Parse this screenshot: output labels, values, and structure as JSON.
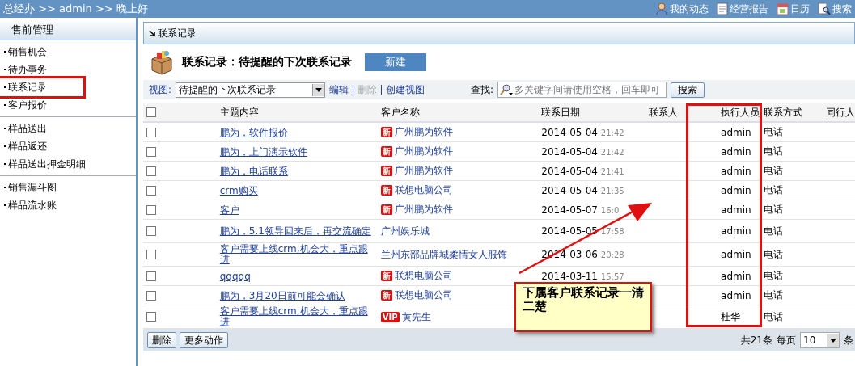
{
  "top_bar": {
    "breadcrumb": "总经办 >> admin >> 晚上好",
    "links": [
      {
        "label": "我的动态"
      },
      {
        "label": "经营报告"
      },
      {
        "label": "日历"
      },
      {
        "label": "搜索"
      }
    ]
  },
  "sidebar": {
    "title": "售前管理",
    "groups": [
      {
        "items": [
          {
            "label": "销售机会",
            "highlighted": false
          },
          {
            "label": "待办事务",
            "highlighted": false
          },
          {
            "label": "联系记录",
            "highlighted": true
          },
          {
            "label": "客户报价",
            "highlighted": false
          }
        ]
      },
      {
        "items": [
          {
            "label": "样品送出",
            "highlighted": false
          },
          {
            "label": "样品返还",
            "highlighted": false
          },
          {
            "label": "样品送出押金明细",
            "highlighted": false
          }
        ]
      },
      {
        "items": [
          {
            "label": "销售漏斗图",
            "highlighted": false
          },
          {
            "label": "样品流水账",
            "highlighted": false
          }
        ]
      }
    ]
  },
  "panel": {
    "title": "联系记录",
    "heading": "联系记录：待提醒的下次联系记录",
    "new_button": "新建",
    "toolbar": {
      "view_label": "视图:",
      "view_value": "待提醒的下次联系记录",
      "actions": [
        {
          "label": "编辑",
          "disabled": false
        },
        {
          "label": "删除",
          "disabled": true
        },
        {
          "label": "创建视图",
          "disabled": false
        }
      ],
      "find_label": "查找:",
      "search_placeholder": "多关键字间请使用空格，回车即可",
      "search_button": "搜索"
    }
  },
  "table": {
    "select_all_checked": false,
    "columns": [
      {
        "label": "主题内容",
        "highlighted": false
      },
      {
        "label": "客户名称",
        "highlighted": false
      },
      {
        "label": "联系日期",
        "highlighted": false
      },
      {
        "label": "联系人",
        "highlighted": false
      },
      {
        "label": "执行人员",
        "highlighted": true
      },
      {
        "label": "联系方式",
        "highlighted": false
      },
      {
        "label": "同行人",
        "highlighted": false
      }
    ],
    "rows": [
      {
        "checked": false,
        "subject": "鹏为，软件报价",
        "tag": "新",
        "customer": "广州鹏为软件",
        "date": "2014-05-04",
        "time": "21:42",
        "executor": "admin",
        "method": "电话"
      },
      {
        "checked": false,
        "subject": "鹏为，上门演示软件",
        "tag": "新",
        "customer": "广州鹏为软件",
        "date": "2014-05-04",
        "time": "21:42",
        "executor": "admin",
        "method": "电话"
      },
      {
        "checked": false,
        "subject": "鹏为，电话联系",
        "tag": "新",
        "customer": "广州鹏为软件",
        "date": "2014-05-04",
        "time": "21:41",
        "executor": "admin",
        "method": "电话"
      },
      {
        "checked": false,
        "subject": "crm购买",
        "tag": "新",
        "customer": "联想电脑公司",
        "date": "2014-05-04",
        "time": "21:35",
        "executor": "admin",
        "method": "电话"
      },
      {
        "checked": false,
        "subject": "客户",
        "tag": "新",
        "customer": "广州鹏为软件",
        "date": "2014-05-07",
        "time": "16:0",
        "executor": "admin",
        "method": "电话"
      },
      {
        "checked": false,
        "subject": "鹏为，5.1领导回来后，再交流确定",
        "customer": "广州娱乐城",
        "date": "2014-05-05",
        "time": "17:58",
        "executor": "admin",
        "method": "电话"
      },
      {
        "checked": false,
        "subject": "客户需要上线crm,机会大，重点跟进",
        "customer": "兰州东部品牌城柔情女人服饰",
        "date": "2014-03-06",
        "time": "20:28",
        "executor": "admin",
        "method": "电话"
      },
      {
        "checked": false,
        "subject": "qqqqq",
        "tag": "新",
        "customer": "联想电脑公司",
        "date": "2014-03-11",
        "time": "15:57",
        "executor": "admin",
        "method": "电话"
      },
      {
        "checked": false,
        "subject": "鹏为，3月20日前可能会确认",
        "tag": "新",
        "customer": "联想电脑公司",
        "executor": "admin",
        "method": "电话"
      },
      {
        "checked": false,
        "subject": "客户需要上线crm,机会大，重点跟进",
        "tag": "VIP",
        "customer": "黄先生",
        "executor": "杜华",
        "method": "电话"
      }
    ]
  },
  "footer": {
    "buttons": [
      "删除",
      "更多动作"
    ],
    "total": "共21条",
    "per_page_label": "每页",
    "per_page": "10",
    "unit": "条"
  },
  "callout": {
    "text": "下属客户联系记录一清二楚"
  }
}
